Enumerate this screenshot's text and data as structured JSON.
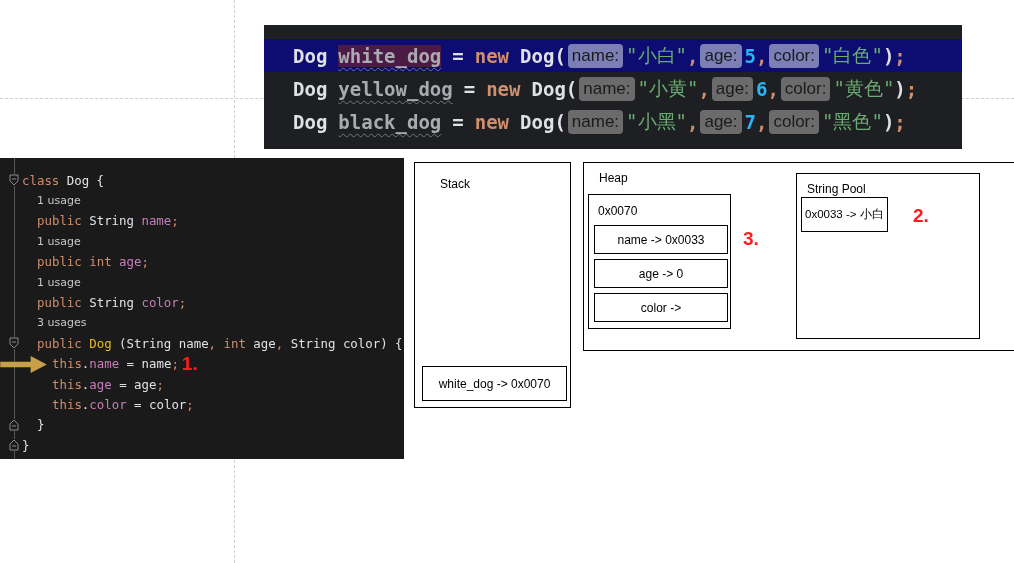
{
  "top_code": {
    "lines": [
      {
        "selected": true,
        "tokens": [
          {
            "kind": "type",
            "text": "Dog"
          },
          {
            "kind": "var",
            "text": "white_dog"
          },
          {
            "kind": "op",
            "text": "="
          },
          {
            "kind": "kw",
            "text": "new"
          },
          {
            "kind": "call",
            "text": "Dog("
          },
          {
            "kind": "hint",
            "text": "name:"
          },
          {
            "kind": "str",
            "text": "\"小白\""
          },
          {
            "kind": "punct",
            "text": ","
          },
          {
            "kind": "hint",
            "text": "age:"
          },
          {
            "kind": "num",
            "text": "5"
          },
          {
            "kind": "punct",
            "text": ","
          },
          {
            "kind": "hint",
            "text": "color:"
          },
          {
            "kind": "str",
            "text": "\"白色\""
          },
          {
            "kind": "plain",
            "text": ")"
          },
          {
            "kind": "punct",
            "text": ";"
          }
        ]
      },
      {
        "selected": false,
        "tokens": [
          {
            "kind": "type",
            "text": "Dog"
          },
          {
            "kind": "var",
            "text": "yellow_dog"
          },
          {
            "kind": "op",
            "text": "="
          },
          {
            "kind": "kw",
            "text": "new"
          },
          {
            "kind": "call",
            "text": "Dog("
          },
          {
            "kind": "hint",
            "text": "name:"
          },
          {
            "kind": "str",
            "text": "\"小黄\""
          },
          {
            "kind": "punct",
            "text": ","
          },
          {
            "kind": "hint",
            "text": "age:"
          },
          {
            "kind": "num",
            "text": "6"
          },
          {
            "kind": "punct",
            "text": ","
          },
          {
            "kind": "hint",
            "text": "color:"
          },
          {
            "kind": "str",
            "text": "\"黄色\""
          },
          {
            "kind": "plain",
            "text": ")"
          },
          {
            "kind": "punct",
            "text": ";"
          }
        ]
      },
      {
        "selected": false,
        "tokens": [
          {
            "kind": "type",
            "text": "Dog"
          },
          {
            "kind": "var",
            "text": "black_dog"
          },
          {
            "kind": "op",
            "text": "="
          },
          {
            "kind": "kw",
            "text": "new"
          },
          {
            "kind": "call",
            "text": "Dog("
          },
          {
            "kind": "hint",
            "text": "name:"
          },
          {
            "kind": "str",
            "text": "\"小黑\""
          },
          {
            "kind": "punct",
            "text": ","
          },
          {
            "kind": "hint",
            "text": "age:"
          },
          {
            "kind": "num",
            "text": "7"
          },
          {
            "kind": "punct",
            "text": ","
          },
          {
            "kind": "hint",
            "text": "color:"
          },
          {
            "kind": "str",
            "text": "\"黑色\""
          },
          {
            "kind": "plain",
            "text": ")"
          },
          {
            "kind": "punct",
            "text": ";"
          }
        ]
      }
    ]
  },
  "class_code": {
    "lines": [
      {
        "kind": "code",
        "foldable": true,
        "tokens": [
          {
            "kind": "kw",
            "text": "class"
          },
          {
            "kind": "plain",
            "text": " Dog {"
          }
        ],
        "children": [
          {
            "kind": "usage",
            "text": "1 usage"
          },
          {
            "kind": "code",
            "tokens": [
              {
                "kind": "kw",
                "text": "public"
              },
              {
                "kind": "plain",
                "text": " String "
              },
              {
                "kind": "field",
                "text": "name"
              },
              {
                "kind": "punct",
                "text": ";"
              }
            ]
          },
          {
            "kind": "usage",
            "text": "1 usage"
          },
          {
            "kind": "code",
            "tokens": [
              {
                "kind": "kw",
                "text": "public int "
              },
              {
                "kind": "field",
                "text": "age"
              },
              {
                "kind": "punct",
                "text": ";"
              }
            ]
          },
          {
            "kind": "usage",
            "text": "1 usage"
          },
          {
            "kind": "code",
            "tokens": [
              {
                "kind": "kw",
                "text": "public"
              },
              {
                "kind": "plain",
                "text": " String "
              },
              {
                "kind": "field",
                "text": "color"
              },
              {
                "kind": "punct",
                "text": ";"
              }
            ]
          },
          {
            "kind": "usage",
            "text": "3 usages"
          },
          {
            "kind": "code",
            "foldable": true,
            "tokens": [
              {
                "kind": "kw",
                "text": "public "
              },
              {
                "kind": "method",
                "text": "Dog"
              },
              {
                "kind": "plain",
                "text": " (String name"
              },
              {
                "kind": "punct",
                "text": ","
              },
              {
                "kind": "kw",
                "text": " int"
              },
              {
                "kind": "plain",
                "text": " age"
              },
              {
                "kind": "punct",
                "text": ","
              },
              {
                "kind": "plain",
                "text": " String color) {"
              }
            ],
            "children": [
              {
                "kind": "code",
                "marker": "1.",
                "tokens": [
                  {
                    "kind": "kw",
                    "text": "this"
                  },
                  {
                    "kind": "plain",
                    "text": "."
                  },
                  {
                    "kind": "field",
                    "text": "name"
                  },
                  {
                    "kind": "plain",
                    "text": " = name"
                  },
                  {
                    "kind": "punct",
                    "text": ";"
                  }
                ]
              },
              {
                "kind": "code",
                "tokens": [
                  {
                    "kind": "kw",
                    "text": "this"
                  },
                  {
                    "kind": "plain",
                    "text": "."
                  },
                  {
                    "kind": "field",
                    "text": "age"
                  },
                  {
                    "kind": "plain",
                    "text": " = age"
                  },
                  {
                    "kind": "punct",
                    "text": ";"
                  }
                ]
              },
              {
                "kind": "code",
                "tokens": [
                  {
                    "kind": "kw",
                    "text": "this"
                  },
                  {
                    "kind": "plain",
                    "text": "."
                  },
                  {
                    "kind": "field",
                    "text": "color"
                  },
                  {
                    "kind": "plain",
                    "text": " = color"
                  },
                  {
                    "kind": "punct",
                    "text": ";"
                  }
                ]
              }
            ]
          },
          {
            "kind": "code",
            "fold_end": true,
            "tokens": [
              {
                "kind": "plain",
                "text": "}"
              }
            ]
          }
        ]
      },
      {
        "kind": "code",
        "fold_end": true,
        "tokens": [
          {
            "kind": "plain",
            "text": "}"
          }
        ]
      }
    ]
  },
  "stack": {
    "title": "Stack",
    "entries": [
      "white_dog -> 0x0070"
    ]
  },
  "heap": {
    "title": "Heap",
    "object": {
      "address": "0x0070",
      "fields": [
        "name -> 0x0033",
        "age -> 0",
        "color ->"
      ]
    },
    "marker": "3."
  },
  "string_pool": {
    "title": "String Pool",
    "entries": [
      "0x0033 -> 小白"
    ],
    "marker": "2."
  }
}
